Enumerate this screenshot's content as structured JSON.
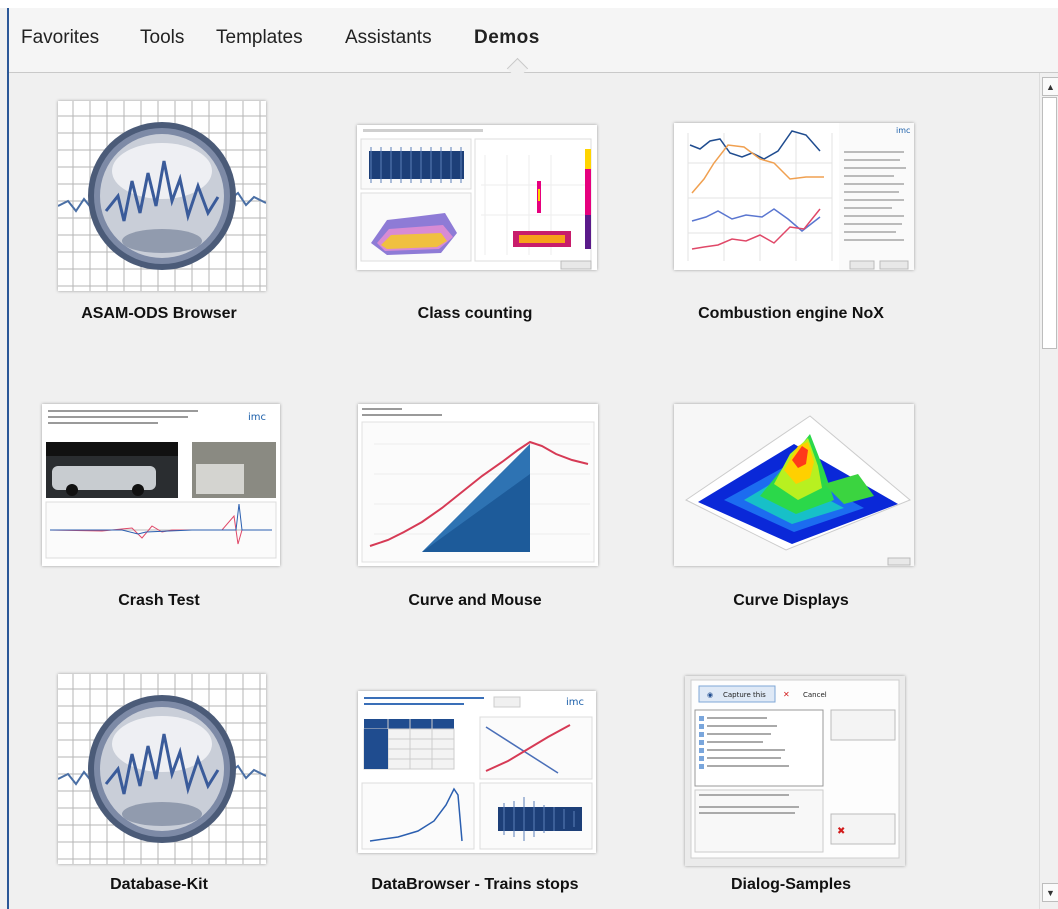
{
  "tabs": [
    {
      "label": "Favorites"
    },
    {
      "label": "Tools"
    },
    {
      "label": "Templates"
    },
    {
      "label": "Assistants"
    },
    {
      "label": "Demos",
      "active": true
    }
  ],
  "tiles": [
    {
      "label": "ASAM-ODS Browser",
      "icon": "magnifier-graph-icon"
    },
    {
      "label": "Class counting",
      "icon": "class-counting-preview"
    },
    {
      "label": "Combustion engine NoX",
      "icon": "combustion-nox-preview"
    },
    {
      "label": "Crash Test",
      "icon": "crash-test-preview"
    },
    {
      "label": "Curve and Mouse",
      "icon": "curve-mouse-preview"
    },
    {
      "label": "Curve Displays",
      "icon": "curve-displays-3d-preview"
    },
    {
      "label": "Database-Kit",
      "icon": "magnifier-graph-icon"
    },
    {
      "label": "DataBrowser - Trains stops",
      "icon": "databrowser-preview"
    },
    {
      "label": "Dialog-Samples",
      "icon": "dialog-samples-preview"
    }
  ],
  "thumb_text": {
    "imc": "imc",
    "capture": "Capture this",
    "cancel": "Cancel"
  },
  "colors": {
    "accent": "#2b5797",
    "bar_blue": "#1d5b9a",
    "curve_red": "#d63a55"
  },
  "scrollbar": {
    "up_icon": "scroll-up-arrow-icon",
    "down_icon": "scroll-down-arrow-icon"
  }
}
